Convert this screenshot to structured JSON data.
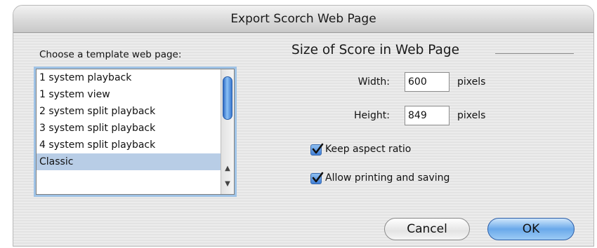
{
  "window": {
    "title": "Export Scorch Web Page"
  },
  "template": {
    "label": "Choose a template web page:",
    "items": [
      "1 system playback",
      "1 system view",
      "2 system split playback",
      "3 system split playback",
      "4 system split playback",
      "Classic"
    ],
    "selected": "Classic"
  },
  "size": {
    "title": "Size of Score in Web Page",
    "width_label": "Width:",
    "width_value": "600",
    "height_label": "Height:",
    "height_value": "849",
    "unit": "pixels"
  },
  "options": {
    "keep_aspect": {
      "label": "Keep aspect ratio",
      "checked": true
    },
    "allow_printing": {
      "label": "Allow printing and saving",
      "checked": true
    }
  },
  "buttons": {
    "cancel": "Cancel",
    "ok": "OK"
  },
  "colors": {
    "accent": "#3f7ed6",
    "selection": "#b8cde6"
  }
}
